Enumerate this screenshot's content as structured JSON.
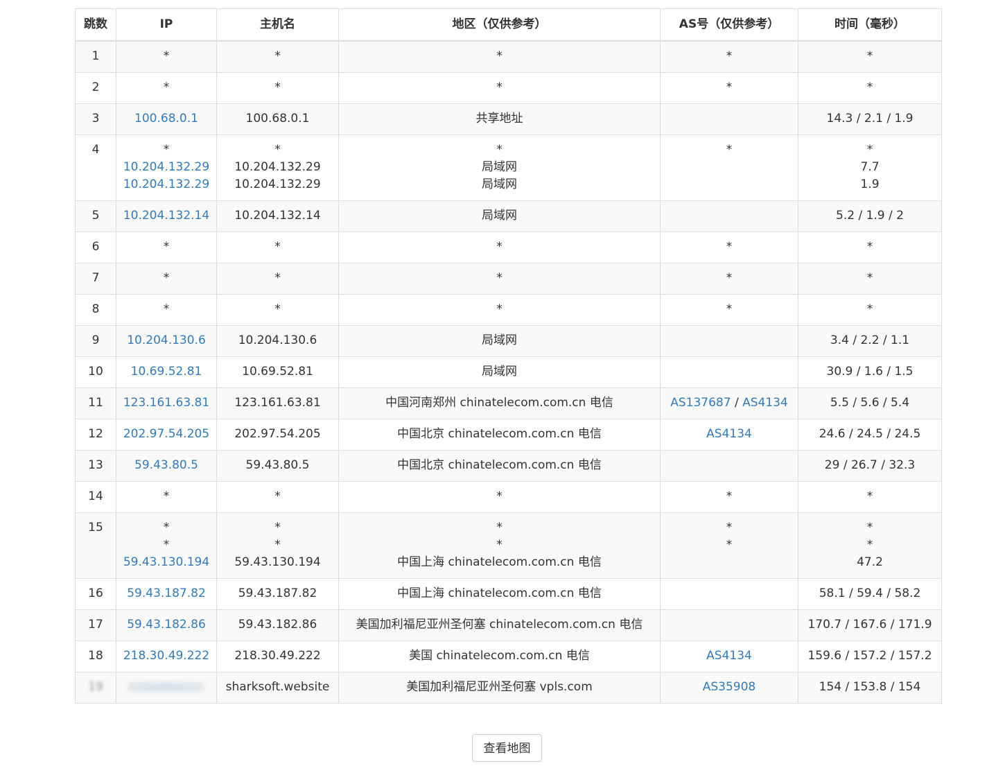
{
  "table": {
    "headers": [
      "跳数",
      "IP",
      "主机名",
      "地区（仅供参考）",
      "AS号（仅供参考）",
      "时间（毫秒）"
    ],
    "rows": [
      {
        "hop": "1",
        "ip": [
          {
            "text": "*",
            "link": false
          }
        ],
        "host": [
          "*"
        ],
        "region": [
          "*"
        ],
        "as": [
          [
            "*"
          ]
        ],
        "time": [
          "*"
        ]
      },
      {
        "hop": "2",
        "ip": [
          {
            "text": "*",
            "link": false
          }
        ],
        "host": [
          "*"
        ],
        "region": [
          "*"
        ],
        "as": [
          [
            "*"
          ]
        ],
        "time": [
          "*"
        ]
      },
      {
        "hop": "3",
        "ip": [
          {
            "text": "100.68.0.1",
            "link": true
          }
        ],
        "host": [
          "100.68.0.1"
        ],
        "region": [
          "共享地址"
        ],
        "as": [
          []
        ],
        "time": [
          "14.3 / 2.1 / 1.9"
        ]
      },
      {
        "hop": "4",
        "ip": [
          {
            "text": "*",
            "link": false
          },
          {
            "text": "10.204.132.29",
            "link": true
          },
          {
            "text": "10.204.132.29",
            "link": true
          }
        ],
        "host": [
          "*",
          "10.204.132.29",
          "10.204.132.29"
        ],
        "region": [
          "*",
          "局域网",
          "局域网"
        ],
        "as": [
          [
            "*"
          ]
        ],
        "time": [
          "*",
          "7.7",
          "1.9"
        ]
      },
      {
        "hop": "5",
        "ip": [
          {
            "text": "10.204.132.14",
            "link": true
          }
        ],
        "host": [
          "10.204.132.14"
        ],
        "region": [
          "局域网"
        ],
        "as": [
          []
        ],
        "time": [
          "5.2 / 1.9 / 2"
        ]
      },
      {
        "hop": "6",
        "ip": [
          {
            "text": "*",
            "link": false
          }
        ],
        "host": [
          "*"
        ],
        "region": [
          "*"
        ],
        "as": [
          [
            "*"
          ]
        ],
        "time": [
          "*"
        ]
      },
      {
        "hop": "7",
        "ip": [
          {
            "text": "*",
            "link": false
          }
        ],
        "host": [
          "*"
        ],
        "region": [
          "*"
        ],
        "as": [
          [
            "*"
          ]
        ],
        "time": [
          "*"
        ]
      },
      {
        "hop": "8",
        "ip": [
          {
            "text": "*",
            "link": false
          }
        ],
        "host": [
          "*"
        ],
        "region": [
          "*"
        ],
        "as": [
          [
            "*"
          ]
        ],
        "time": [
          "*"
        ]
      },
      {
        "hop": "9",
        "ip": [
          {
            "text": "10.204.130.6",
            "link": true
          }
        ],
        "host": [
          "10.204.130.6"
        ],
        "region": [
          "局域网"
        ],
        "as": [
          []
        ],
        "time": [
          "3.4 / 2.2 / 1.1"
        ]
      },
      {
        "hop": "10",
        "ip": [
          {
            "text": "10.69.52.81",
            "link": true
          }
        ],
        "host": [
          "10.69.52.81"
        ],
        "region": [
          "局域网"
        ],
        "as": [
          []
        ],
        "time": [
          "30.9 / 1.6 / 1.5"
        ]
      },
      {
        "hop": "11",
        "ip": [
          {
            "text": "123.161.63.81",
            "link": true
          }
        ],
        "host": [
          "123.161.63.81"
        ],
        "region": [
          "中国河南郑州 chinatelecom.com.cn 电信"
        ],
        "as": [
          [
            "AS137687",
            "AS4134"
          ]
        ],
        "time": [
          "5.5 / 5.6 / 5.4"
        ]
      },
      {
        "hop": "12",
        "ip": [
          {
            "text": "202.97.54.205",
            "link": true
          }
        ],
        "host": [
          "202.97.54.205"
        ],
        "region": [
          "中国北京 chinatelecom.com.cn 电信"
        ],
        "as": [
          [
            "AS4134"
          ]
        ],
        "time": [
          "24.6 / 24.5 / 24.5"
        ]
      },
      {
        "hop": "13",
        "ip": [
          {
            "text": "59.43.80.5",
            "link": true
          }
        ],
        "host": [
          "59.43.80.5"
        ],
        "region": [
          "中国北京 chinatelecom.com.cn 电信"
        ],
        "as": [
          []
        ],
        "time": [
          "29 / 26.7 / 32.3"
        ]
      },
      {
        "hop": "14",
        "ip": [
          {
            "text": "*",
            "link": false
          }
        ],
        "host": [
          "*"
        ],
        "region": [
          "*"
        ],
        "as": [
          [
            "*"
          ]
        ],
        "time": [
          "*"
        ]
      },
      {
        "hop": "15",
        "ip": [
          {
            "text": "*",
            "link": false
          },
          {
            "text": "*",
            "link": false
          },
          {
            "text": "59.43.130.194",
            "link": true
          }
        ],
        "host": [
          "*",
          "*",
          "59.43.130.194"
        ],
        "region": [
          "*",
          "*",
          "中国上海 chinatelecom.com.cn 电信"
        ],
        "as": [
          [
            "*"
          ],
          [
            "*"
          ]
        ],
        "time": [
          "*",
          "*",
          "47.2"
        ]
      },
      {
        "hop": "16",
        "ip": [
          {
            "text": "59.43.187.82",
            "link": true
          }
        ],
        "host": [
          "59.43.187.82"
        ],
        "region": [
          "中国上海 chinatelecom.com.cn 电信"
        ],
        "as": [
          []
        ],
        "time": [
          "58.1 / 59.4 / 58.2"
        ]
      },
      {
        "hop": "17",
        "ip": [
          {
            "text": "59.43.182.86",
            "link": true
          }
        ],
        "host": [
          "59.43.182.86"
        ],
        "region": [
          "美国加利福尼亚州圣何塞 chinatelecom.com.cn 电信"
        ],
        "as": [
          []
        ],
        "time": [
          "170.7 / 167.6 / 171.9"
        ]
      },
      {
        "hop": "18",
        "ip": [
          {
            "text": "218.30.49.222",
            "link": true
          }
        ],
        "host": [
          "218.30.49.222"
        ],
        "region": [
          "美国 chinatelecom.com.cn 电信"
        ],
        "as": [
          [
            "AS4134"
          ]
        ],
        "time": [
          "159.6 / 157.2 / 157.2"
        ]
      },
      {
        "hop": "19",
        "ip": [
          {
            "text": "",
            "link": false,
            "redacted": true
          }
        ],
        "host": [
          "sharksoft.website"
        ],
        "region": [
          "美国加利福尼亚州圣何塞 vpls.com"
        ],
        "as": [
          [
            "AS35908"
          ]
        ],
        "time": [
          "154 / 153.8 / 154"
        ],
        "hop_redacted": true
      }
    ]
  },
  "button": {
    "label": "查看地图"
  },
  "colors": {
    "link": "#337ab7",
    "stripe": "#f9f9f9",
    "border": "#dddddd"
  }
}
